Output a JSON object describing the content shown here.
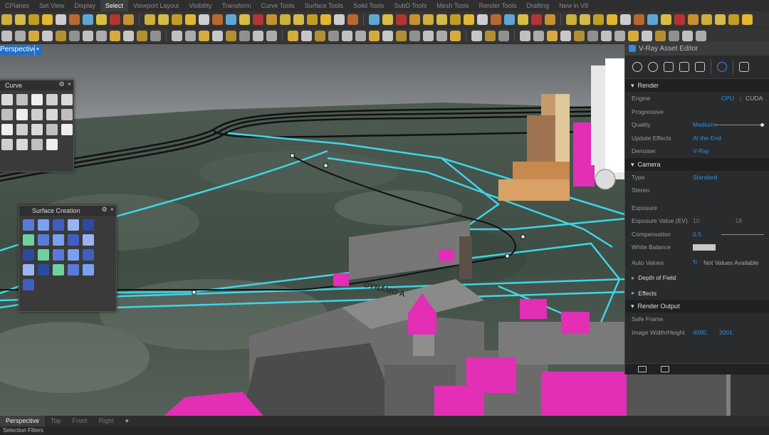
{
  "menu_tabs": [
    "CPlanes",
    "Set View",
    "Display",
    "Select",
    "Viewport Layout",
    "Visibility",
    "Transform",
    "Curve Tools",
    "Surface Tools",
    "Solid Tools",
    "SubD Tools",
    "Mesh Tools",
    "Render Tools",
    "Drafting",
    "New in V8"
  ],
  "active_menu_tab": "Select",
  "viewport": {
    "label": "Perspective",
    "caret": "▾"
  },
  "building_text": "DYNAMO A",
  "curve_panel": {
    "title": "Curve"
  },
  "surface_panel": {
    "title": "Surface Creation"
  },
  "panel_controls": {
    "gear": "⚙",
    "close": "×"
  },
  "vray": {
    "title": "V-Ray Asset Editor",
    "sections": {
      "render": "Render",
      "camera": "Camera",
      "depth_of_field": "Depth of Field",
      "effects": "Effects",
      "render_output": "Render Output"
    },
    "render": {
      "engine_label": "Engine",
      "engine_cpu": "CPU",
      "engine_cuda": "CUDA",
      "progressive_label": "Progressive",
      "quality_label": "Quality",
      "quality_value": "Medium+",
      "update_effects_label": "Update Effects",
      "update_effects_value": "At the End",
      "denoiser_label": "Denoiser",
      "denoiser_value": "V-Ray"
    },
    "camera": {
      "type_label": "Type",
      "type_value": "Standard",
      "stereo_label": "Stereo",
      "exposure_label": "Exposure",
      "exposure_value_label": "Exposure Value (EV)",
      "exposure_value": "10",
      "exposure_value_2": "18",
      "compensation_label": "Compensation",
      "compensation_value": "0.5",
      "white_balance_label": "White Balance"
    },
    "auto_values": {
      "label": "Auto Values",
      "value": "Not Values Available"
    },
    "render_output": {
      "safe_frame_label": "Safe Frame",
      "image_wh_label": "Image Width/Height",
      "width": "4000",
      "height": "2001"
    }
  },
  "view_tabs": [
    "Perspective",
    "Top",
    "Front",
    "Right"
  ],
  "active_view_tab": "Perspective",
  "add_tab": "+",
  "status_text": "Selection Filters",
  "colors": {
    "accent": "#2f8fe3",
    "selected_tab": "#1e70c8",
    "magenta": "#e22fb6",
    "curve_cyan": "#3dd6e6"
  }
}
